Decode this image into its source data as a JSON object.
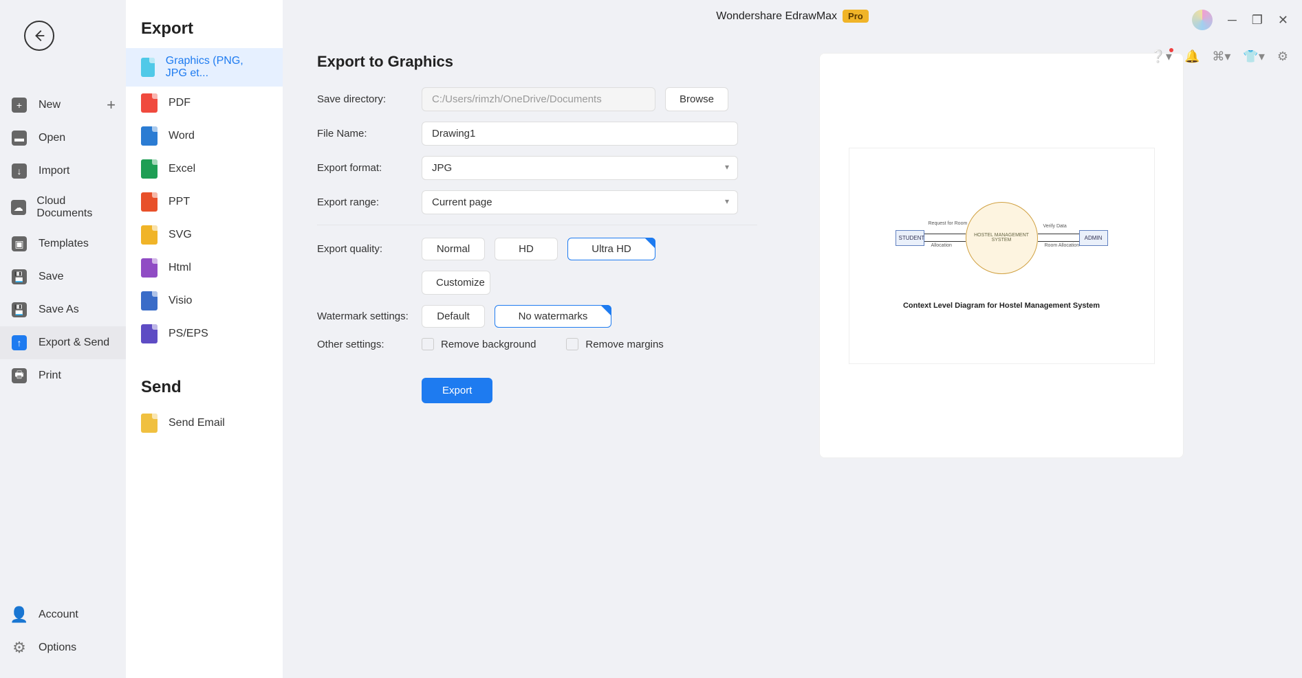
{
  "app": {
    "title": "Wondershare EdrawMax",
    "badge": "Pro"
  },
  "sidebar": {
    "back": "←",
    "items": [
      {
        "icon": "plus",
        "label": "New",
        "trailing": "+"
      },
      {
        "icon": "folder",
        "label": "Open"
      },
      {
        "icon": "import",
        "label": "Import"
      },
      {
        "icon": "cloud",
        "label": "Cloud Documents"
      },
      {
        "icon": "templates",
        "label": "Templates"
      },
      {
        "icon": "save",
        "label": "Save"
      },
      {
        "icon": "saveas",
        "label": "Save As"
      },
      {
        "icon": "export",
        "label": "Export & Send"
      },
      {
        "icon": "print",
        "label": "Print"
      }
    ],
    "bottom": [
      {
        "label": "Account"
      },
      {
        "label": "Options"
      }
    ]
  },
  "export_panel": {
    "title": "Export",
    "items": [
      {
        "label": "Graphics (PNG, JPG et...",
        "type": "img",
        "active": true
      },
      {
        "label": "PDF",
        "type": "pdf"
      },
      {
        "label": "Word",
        "type": "word"
      },
      {
        "label": "Excel",
        "type": "excel"
      },
      {
        "label": "PPT",
        "type": "ppt"
      },
      {
        "label": "SVG",
        "type": "svg"
      },
      {
        "label": "Html",
        "type": "html"
      },
      {
        "label": "Visio",
        "type": "visio"
      },
      {
        "label": "PS/EPS",
        "type": "ps"
      }
    ],
    "send_title": "Send",
    "send_items": [
      {
        "label": "Send Email",
        "type": "email"
      }
    ]
  },
  "form": {
    "title": "Export to Graphics",
    "save_dir_label": "Save directory:",
    "save_dir": "C:/Users/rimzh/OneDrive/Documents",
    "browse": "Browse",
    "filename_label": "File Name:",
    "filename": "Drawing1",
    "format_label": "Export format:",
    "format": "JPG",
    "range_label": "Export range:",
    "range": "Current page",
    "quality_label": "Export quality:",
    "quality": [
      "Normal",
      "HD",
      "Ultra HD"
    ],
    "customize": "Customize",
    "watermark_label": "Watermark settings:",
    "watermark": [
      "Default",
      "No watermarks"
    ],
    "other_label": "Other settings:",
    "remove_bg": "Remove background",
    "remove_margin": "Remove margins",
    "export": "Export"
  },
  "preview": {
    "student": "STUDENT",
    "center": "HOSTEL MANAGEMENT SYSTEM",
    "admin": "ADMIN",
    "req": "Request for Room",
    "alloc": "Allocation",
    "verify": "Verify Data",
    "room_alloc": "Room Allocation",
    "caption": "Context Level Diagram for Hostel Management System"
  }
}
